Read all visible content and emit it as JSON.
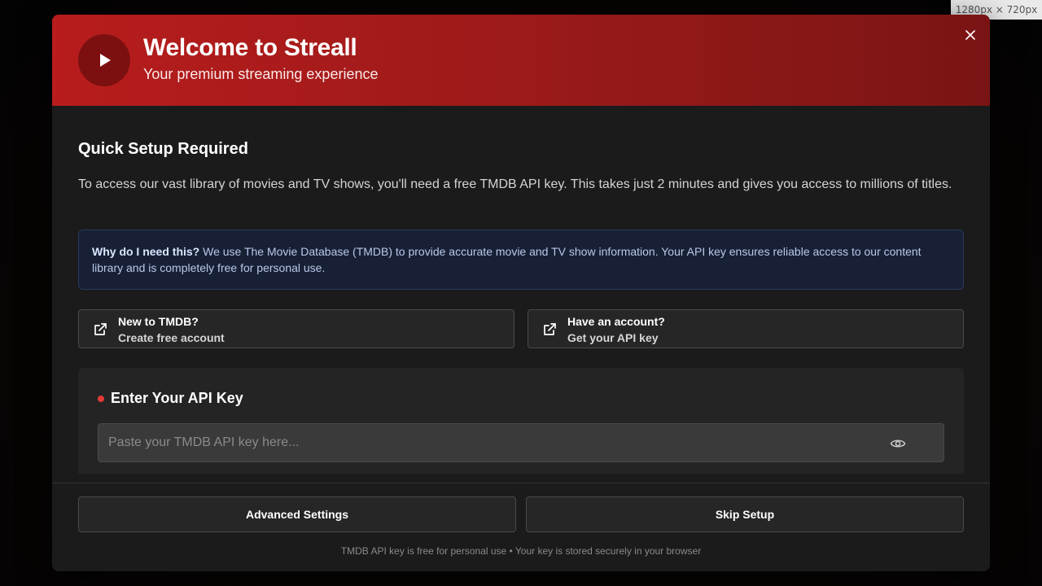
{
  "overlay": {
    "dimension_label": "1280px × 720px"
  },
  "header": {
    "title": "Welcome to Streall",
    "subtitle": "Your premium streaming experience",
    "logo_icon": "play-icon",
    "close_icon": "close-icon"
  },
  "setup": {
    "title": "Quick Setup Required",
    "intro": "To access our vast library of movies and TV shows, you'll need a free TMDB API key. This takes just 2 minutes and gives you access to millions of titles.",
    "info_label": "Why do I need this?",
    "info_text": " We use The Movie Database (TMDB) to provide accurate movie and TV show information. Your API key ensures reliable access to our content library and is completely free for personal use."
  },
  "links": [
    {
      "title": "New to TMDB?",
      "subtitle": "Create free account",
      "icon": "external-link-icon"
    },
    {
      "title": "Have an account?",
      "subtitle": "Get your API key",
      "icon": "external-link-icon"
    }
  ],
  "api": {
    "title": "Enter Your API Key",
    "placeholder": "Paste your TMDB API key here...",
    "value": "",
    "toggle_icon": "eye-icon"
  },
  "footer": {
    "advanced_label": "Advanced Settings",
    "skip_label": "Skip Setup",
    "note": "TMDB API key is free for personal use • Your key is stored securely in your browser"
  },
  "colors": {
    "accent": "#b81c1c",
    "info_bg": "#172035",
    "required_dot": "#e53935"
  }
}
